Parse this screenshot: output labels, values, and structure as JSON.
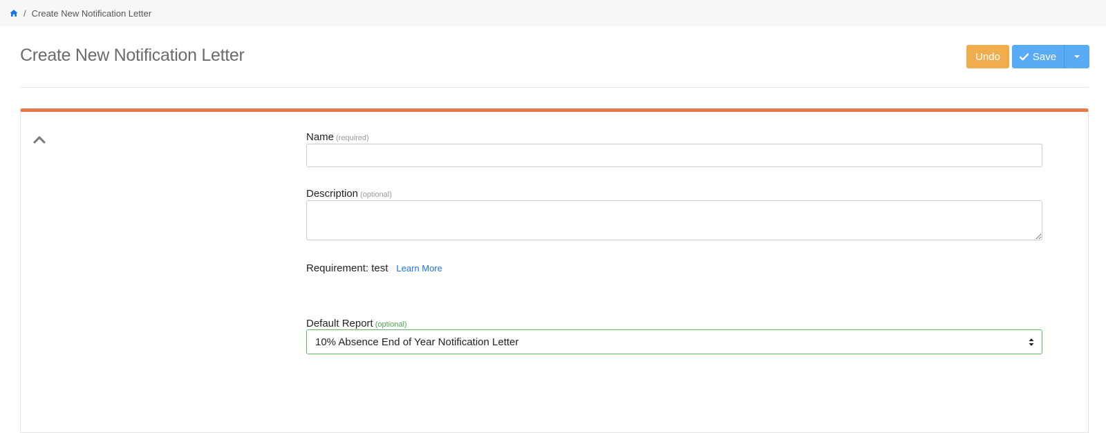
{
  "breadcrumb": {
    "home_icon": "home-icon",
    "separator": "/",
    "current": "Create New Notification Letter"
  },
  "header": {
    "title": "Create New Notification Letter",
    "undo_label": "Undo",
    "save_label": "Save",
    "save_icon": "check-icon",
    "dropdown_icon": "caret-down-icon"
  },
  "colors": {
    "accent_bar": "#e8794a",
    "undo": "#f0ad4e",
    "save": "#5aabf6",
    "valid_border": "#5cb85c",
    "link": "#1a73e8"
  },
  "panel": {
    "collapse_icon": "chevron-up-icon"
  },
  "form": {
    "name": {
      "label": "Name",
      "hint": "(required)",
      "value": ""
    },
    "description": {
      "label": "Description",
      "hint": "(optional)",
      "value": ""
    },
    "requirement": {
      "text": "Requirement: test",
      "link_label": "Learn More"
    },
    "default_report": {
      "label": "Default Report",
      "hint": "(optional)",
      "selected": "10% Absence End of Year Notification Letter"
    }
  }
}
